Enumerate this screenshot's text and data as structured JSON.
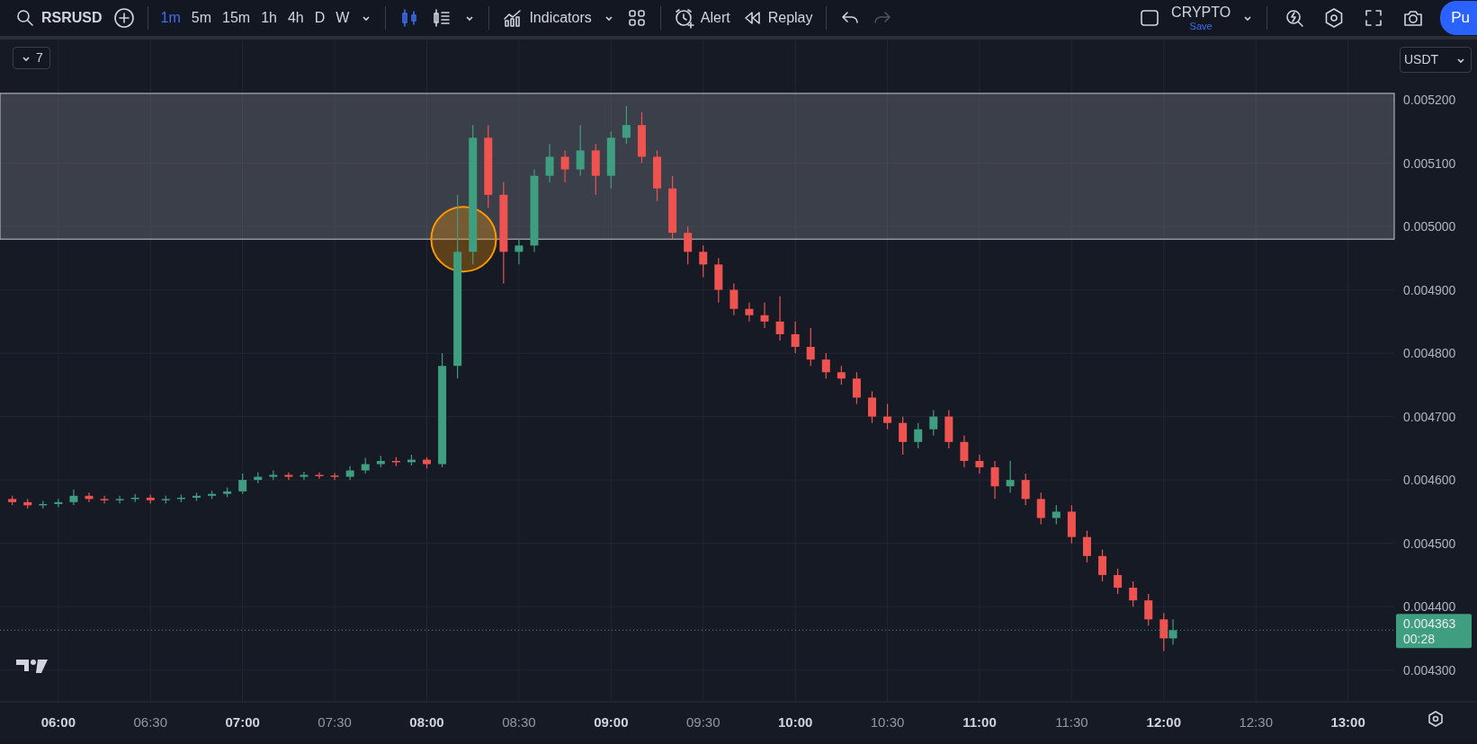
{
  "toolbar": {
    "symbol": "RSRUSD",
    "intervals": [
      {
        "label": "1m",
        "selected": true
      },
      {
        "label": "5m",
        "selected": false
      },
      {
        "label": "15m",
        "selected": false
      },
      {
        "label": "1h",
        "selected": false
      },
      {
        "label": "4h",
        "selected": false
      },
      {
        "label": "D",
        "selected": false
      },
      {
        "label": "W",
        "selected": false
      }
    ],
    "indicators_label": "Indicators",
    "alert_label": "Alert",
    "replay_label": "Replay",
    "redo_disabled": true,
    "layout": {
      "name": "CRYPTO",
      "save_label": "Save"
    },
    "publish_button": "Pu"
  },
  "chart": {
    "collapse_count": "7",
    "currency": "USDT",
    "price_label": "0.004363",
    "countdown": "00:28",
    "chart_data": {
      "type": "candlestick",
      "grid": true,
      "x": [
        345,
        350,
        355,
        360,
        365,
        370,
        375,
        380,
        385,
        390,
        395,
        400,
        405,
        410,
        415,
        420,
        425,
        430,
        435,
        440,
        445,
        450,
        455,
        460,
        465,
        470,
        475,
        480,
        485,
        490,
        495,
        500,
        505,
        510,
        515,
        520,
        525,
        530,
        535,
        540,
        545,
        550,
        555,
        560,
        565,
        570,
        575,
        580,
        585,
        590,
        595,
        600,
        605,
        610,
        615,
        620,
        625,
        630,
        635,
        640,
        645,
        650,
        655,
        660,
        665,
        670,
        675,
        680,
        685,
        690,
        695,
        700,
        705,
        710,
        715,
        720,
        723
      ],
      "ohlc": [
        [
          0.00457,
          0.004575,
          0.00456,
          0.004565
        ],
        [
          0.004565,
          0.00457,
          0.004555,
          0.00456
        ],
        [
          0.00456,
          0.004567,
          0.004555,
          0.004562
        ],
        [
          0.004562,
          0.00457,
          0.004557,
          0.004565
        ],
        [
          0.004565,
          0.004585,
          0.00456,
          0.004575
        ],
        [
          0.004575,
          0.00458,
          0.004565,
          0.00457
        ],
        [
          0.00457,
          0.004575,
          0.004563,
          0.004568
        ],
        [
          0.004568,
          0.004575,
          0.004563,
          0.00457
        ],
        [
          0.00457,
          0.004578,
          0.004565,
          0.004572
        ],
        [
          0.004572,
          0.004577,
          0.004563,
          0.004568
        ],
        [
          0.004568,
          0.004575,
          0.004563,
          0.00457
        ],
        [
          0.00457,
          0.004577,
          0.004565,
          0.004572
        ],
        [
          0.004572,
          0.00458,
          0.004567,
          0.004575
        ],
        [
          0.004575,
          0.004583,
          0.00457,
          0.004578
        ],
        [
          0.004578,
          0.004588,
          0.004573,
          0.004582
        ],
        [
          0.004582,
          0.00461,
          0.004578,
          0.0046
        ],
        [
          0.0046,
          0.004612,
          0.004595,
          0.004605
        ],
        [
          0.004605,
          0.004615,
          0.0046,
          0.004608
        ],
        [
          0.004608,
          0.004612,
          0.0046,
          0.004605
        ],
        [
          0.004605,
          0.004613,
          0.0046,
          0.004608
        ],
        [
          0.004608,
          0.004612,
          0.004602,
          0.004607
        ],
        [
          0.004607,
          0.004611,
          0.0046,
          0.004605
        ],
        [
          0.004605,
          0.004622,
          0.0046,
          0.004615
        ],
        [
          0.004615,
          0.004635,
          0.00461,
          0.004625
        ],
        [
          0.004625,
          0.004638,
          0.00462,
          0.00463
        ],
        [
          0.00463,
          0.004636,
          0.004622,
          0.004628
        ],
        [
          0.004628,
          0.00464,
          0.004623,
          0.004632
        ],
        [
          0.004632,
          0.004636,
          0.004618,
          0.004625
        ],
        [
          0.004625,
          0.0048,
          0.00462,
          0.00478
        ],
        [
          0.00478,
          0.00505,
          0.00476,
          0.00496
        ],
        [
          0.00496,
          0.00516,
          0.00494,
          0.00514
        ],
        [
          0.00514,
          0.00516,
          0.00503,
          0.00505
        ],
        [
          0.00505,
          0.00507,
          0.00491,
          0.00496
        ],
        [
          0.00496,
          0.00498,
          0.00494,
          0.00497
        ],
        [
          0.00497,
          0.00509,
          0.00496,
          0.00508
        ],
        [
          0.00508,
          0.00513,
          0.00507,
          0.00511
        ],
        [
          0.00511,
          0.00512,
          0.00507,
          0.00509
        ],
        [
          0.00509,
          0.00516,
          0.00508,
          0.00512
        ],
        [
          0.00512,
          0.00513,
          0.00505,
          0.00508
        ],
        [
          0.00508,
          0.00515,
          0.00506,
          0.00514
        ],
        [
          0.00514,
          0.00519,
          0.00513,
          0.00516
        ],
        [
          0.00516,
          0.00518,
          0.0051,
          0.00511
        ],
        [
          0.00511,
          0.00512,
          0.00504,
          0.00506
        ],
        [
          0.00506,
          0.00508,
          0.00498,
          0.00499
        ],
        [
          0.00499,
          0.005,
          0.00494,
          0.00496
        ],
        [
          0.00496,
          0.00497,
          0.00492,
          0.00494
        ],
        [
          0.00494,
          0.00495,
          0.00488,
          0.0049
        ],
        [
          0.0049,
          0.00491,
          0.00486,
          0.00487
        ],
        [
          0.00487,
          0.00488,
          0.00485,
          0.00486
        ],
        [
          0.00486,
          0.00488,
          0.00484,
          0.00485
        ],
        [
          0.00485,
          0.00489,
          0.00482,
          0.00483
        ],
        [
          0.00483,
          0.00485,
          0.0048,
          0.00481
        ],
        [
          0.00481,
          0.00484,
          0.00478,
          0.00479
        ],
        [
          0.00479,
          0.0048,
          0.00476,
          0.00477
        ],
        [
          0.00477,
          0.00478,
          0.00475,
          0.00476
        ],
        [
          0.00476,
          0.00477,
          0.00472,
          0.00473
        ],
        [
          0.00473,
          0.00474,
          0.00469,
          0.0047
        ],
        [
          0.0047,
          0.00472,
          0.00468,
          0.00469
        ],
        [
          0.00469,
          0.0047,
          0.00464,
          0.00466
        ],
        [
          0.00466,
          0.00469,
          0.00465,
          0.00468
        ],
        [
          0.00468,
          0.00471,
          0.00467,
          0.0047
        ],
        [
          0.0047,
          0.00471,
          0.00465,
          0.00466
        ],
        [
          0.00466,
          0.00467,
          0.00462,
          0.00463
        ],
        [
          0.00463,
          0.00464,
          0.00461,
          0.00462
        ],
        [
          0.00462,
          0.00463,
          0.00457,
          0.00459
        ],
        [
          0.00459,
          0.00463,
          0.00458,
          0.0046
        ],
        [
          0.0046,
          0.00461,
          0.00456,
          0.00457
        ],
        [
          0.00457,
          0.00458,
          0.00453,
          0.00454
        ],
        [
          0.00454,
          0.00456,
          0.00453,
          0.00455
        ],
        [
          0.00455,
          0.00456,
          0.0045,
          0.00451
        ],
        [
          0.00451,
          0.00452,
          0.00447,
          0.00448
        ],
        [
          0.00448,
          0.00449,
          0.00444,
          0.00445
        ],
        [
          0.00445,
          0.00446,
          0.00442,
          0.00443
        ],
        [
          0.00443,
          0.00444,
          0.0044,
          0.00441
        ],
        [
          0.00441,
          0.00442,
          0.00437,
          0.00438
        ],
        [
          0.00438,
          0.00439,
          0.00433,
          0.00435
        ],
        [
          0.00435,
          0.00438,
          0.00434,
          0.004363
        ]
      ],
      "xlim": [
        341,
        822
      ],
      "ylim": [
        0.00425,
        0.005295
      ],
      "bands": [
        {
          "axis": "y",
          "from": 0.00498,
          "to": 0.00521
        }
      ],
      "ref_lines": [
        {
          "axis": "y",
          "value": 0.004363,
          "color": "#3f9e7f"
        }
      ],
      "xticks": [
        {
          "value": 360,
          "label": "06:00"
        },
        {
          "value": 390,
          "label": "06:30"
        },
        {
          "value": 420,
          "label": "07:00"
        },
        {
          "value": 450,
          "label": "07:30"
        },
        {
          "value": 480,
          "label": "08:00"
        },
        {
          "value": 510,
          "label": "08:30"
        },
        {
          "value": 540,
          "label": "09:00"
        },
        {
          "value": 570,
          "label": "09:30"
        },
        {
          "value": 600,
          "label": "10:00"
        },
        {
          "value": 630,
          "label": "10:30"
        },
        {
          "value": 660,
          "label": "11:00"
        },
        {
          "value": 690,
          "label": "11:30"
        },
        {
          "value": 720,
          "label": "12:00"
        },
        {
          "value": 750,
          "label": "12:30"
        },
        {
          "value": 780,
          "label": "13:00"
        }
      ],
      "yticks": [
        {
          "value": 0.0043,
          "label": "0.004300"
        },
        {
          "value": 0.0044,
          "label": "0.004400"
        },
        {
          "value": 0.0045,
          "label": "0.004500"
        },
        {
          "value": 0.0046,
          "label": "0.004600"
        },
        {
          "value": 0.0047,
          "label": "0.004700"
        },
        {
          "value": 0.0048,
          "label": "0.004800"
        },
        {
          "value": 0.0049,
          "label": "0.004900"
        },
        {
          "value": 0.005,
          "label": "0.005000"
        },
        {
          "value": 0.0051,
          "label": "0.005100"
        },
        {
          "value": 0.0052,
          "label": "0.005200"
        }
      ]
    }
  }
}
